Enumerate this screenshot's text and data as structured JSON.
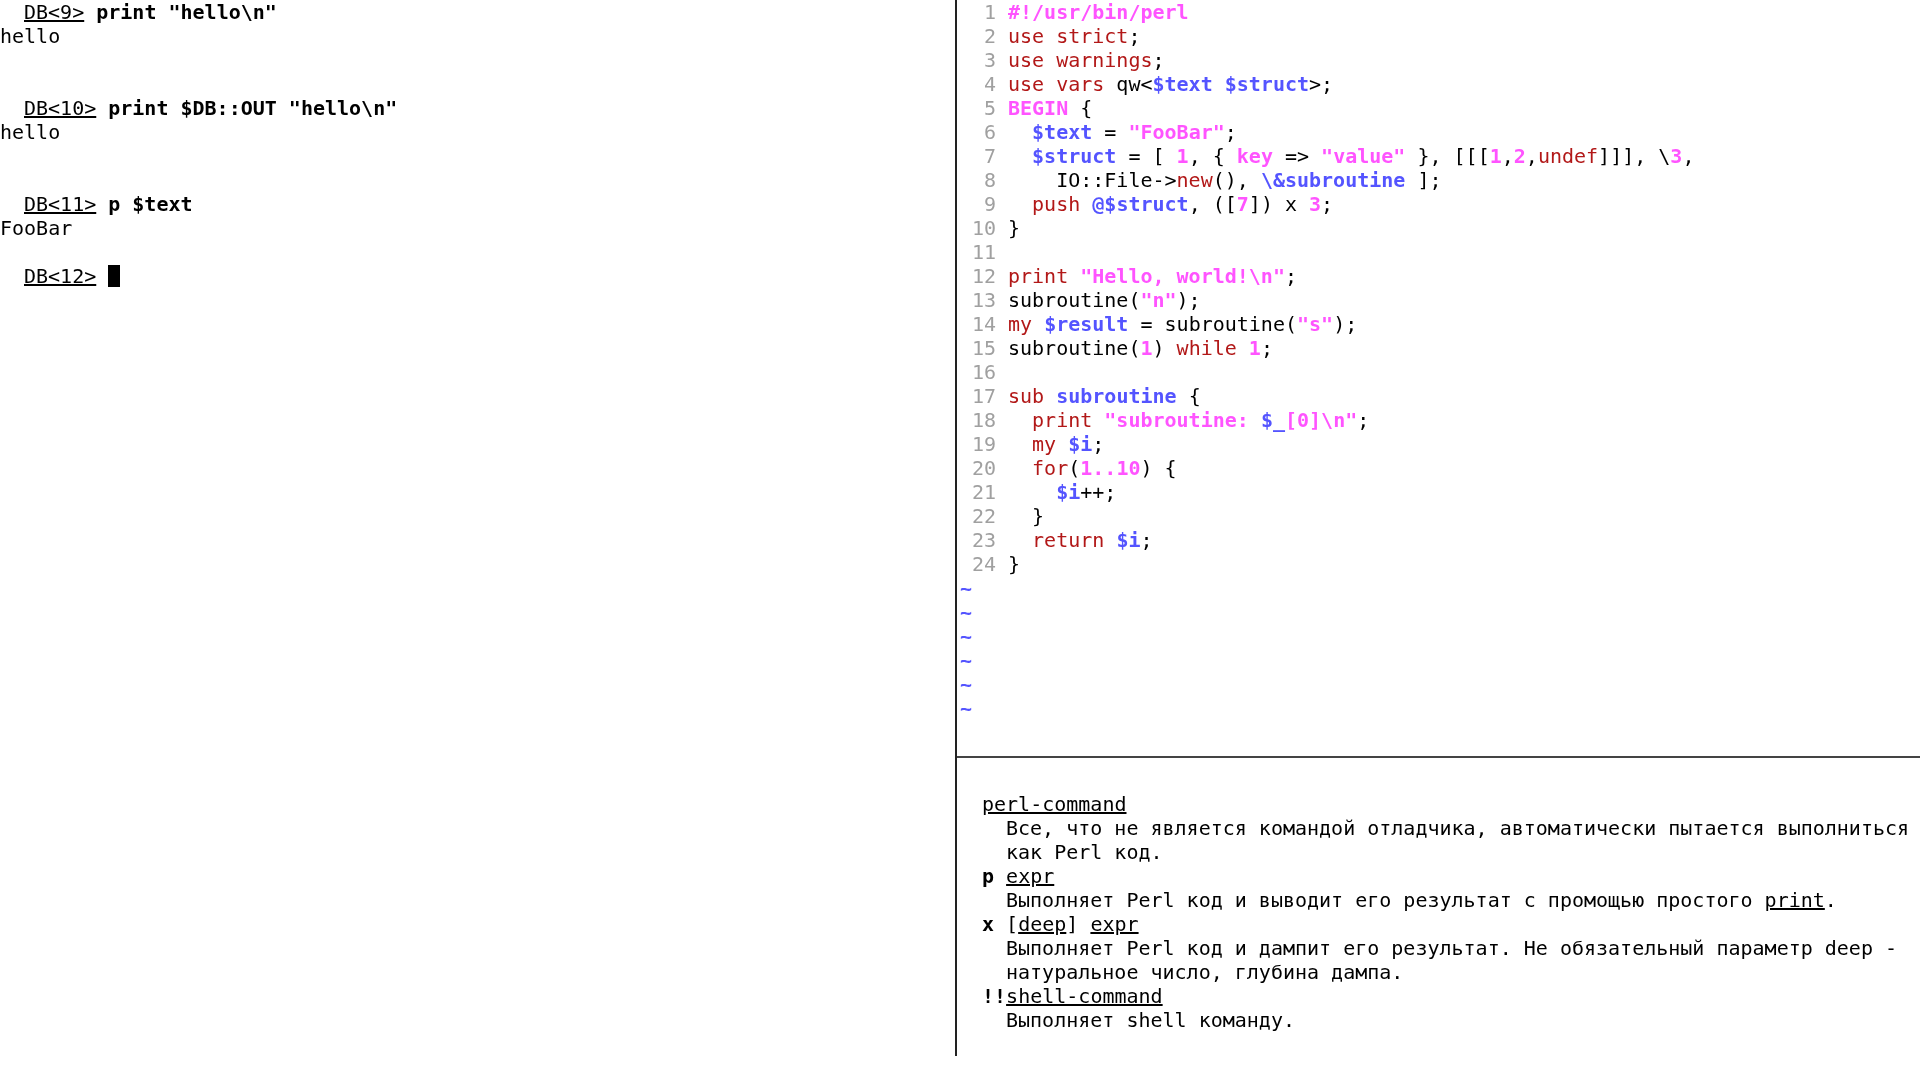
{
  "console": {
    "lines": [
      {
        "kind": "prompt",
        "prompt": "DB<9>",
        "command": "print \"hello\\n\""
      },
      {
        "kind": "output",
        "text": "hello"
      },
      {
        "kind": "blank"
      },
      {
        "kind": "blank"
      },
      {
        "kind": "prompt",
        "prompt": "DB<10>",
        "command": "print $DB::OUT \"hello\\n\""
      },
      {
        "kind": "output",
        "text": "hello"
      },
      {
        "kind": "blank"
      },
      {
        "kind": "blank"
      },
      {
        "kind": "prompt",
        "prompt": "DB<11>",
        "command": "p $text"
      },
      {
        "kind": "output",
        "text": "FooBar"
      },
      {
        "kind": "blank"
      },
      {
        "kind": "prompt",
        "prompt": "DB<12>",
        "cursor": true
      }
    ]
  },
  "editor": {
    "lines": [
      {
        "number": "1",
        "tokens": [
          {
            "kind": "constant",
            "text": "#!/usr/bin/perl"
          }
        ]
      },
      {
        "number": "2",
        "tokens": [
          {
            "kind": "keyword",
            "text": "use strict"
          },
          {
            "kind": "plain",
            "text": ";"
          }
        ]
      },
      {
        "number": "3",
        "tokens": [
          {
            "kind": "keyword",
            "text": "use warnings"
          },
          {
            "kind": "plain",
            "text": ";"
          }
        ]
      },
      {
        "number": "4",
        "tokens": [
          {
            "kind": "keyword",
            "text": "use vars"
          },
          {
            "kind": "plain",
            "text": " qw<"
          },
          {
            "kind": "variable",
            "text": "$text $struct"
          },
          {
            "kind": "plain",
            "text": ">;"
          }
        ]
      },
      {
        "number": "5",
        "tokens": [
          {
            "kind": "constant",
            "text": "BEGIN"
          },
          {
            "kind": "plain",
            "text": " {"
          }
        ]
      },
      {
        "number": "6",
        "tokens": [
          {
            "kind": "variable",
            "text": "  $text"
          },
          {
            "kind": "plain",
            "text": " = "
          },
          {
            "kind": "constant",
            "text": "\"FooBar\""
          },
          {
            "kind": "plain",
            "text": ";"
          }
        ]
      },
      {
        "number": "7",
        "tokens": [
          {
            "kind": "variable",
            "text": "  $struct"
          },
          {
            "kind": "plain",
            "text": " = [ "
          },
          {
            "kind": "constant",
            "text": "1"
          },
          {
            "kind": "plain",
            "text": ", { "
          },
          {
            "kind": "constant",
            "text": "key"
          },
          {
            "kind": "plain",
            "text": " => "
          },
          {
            "kind": "constant",
            "text": "\"value\""
          },
          {
            "kind": "plain",
            "text": " }, [[["
          },
          {
            "kind": "constant",
            "text": "1"
          },
          {
            "kind": "plain",
            "text": ","
          },
          {
            "kind": "constant",
            "text": "2"
          },
          {
            "kind": "plain",
            "text": ","
          },
          {
            "kind": "keyword",
            "text": "undef"
          },
          {
            "kind": "plain",
            "text": "]]], \\"
          },
          {
            "kind": "constant",
            "text": "3"
          },
          {
            "kind": "plain",
            "text": ","
          }
        ]
      },
      {
        "number": "8",
        "tokens": [
          {
            "kind": "plain",
            "text": "    IO::File->"
          },
          {
            "kind": "keyword",
            "text": "new"
          },
          {
            "kind": "plain",
            "text": "(), "
          },
          {
            "kind": "variable",
            "text": "\\&subroutine"
          },
          {
            "kind": "plain",
            "text": " ];"
          }
        ]
      },
      {
        "number": "9",
        "tokens": [
          {
            "kind": "keyword",
            "text": "  push "
          },
          {
            "kind": "variable",
            "text": "@$struct"
          },
          {
            "kind": "plain",
            "text": ", (["
          },
          {
            "kind": "constant",
            "text": "7"
          },
          {
            "kind": "plain",
            "text": "]) x "
          },
          {
            "kind": "constant",
            "text": "3"
          },
          {
            "kind": "plain",
            "text": ";"
          }
        ]
      },
      {
        "number": "10",
        "tokens": [
          {
            "kind": "plain",
            "text": "}"
          }
        ]
      },
      {
        "number": "11"
      },
      {
        "number": "12",
        "tokens": [
          {
            "kind": "keyword",
            "text": "print "
          },
          {
            "kind": "constant",
            "text": "\"Hello, world!\\n\""
          },
          {
            "kind": "plain",
            "text": ";"
          }
        ]
      },
      {
        "number": "13",
        "tokens": [
          {
            "kind": "plain",
            "text": "subroutine("
          },
          {
            "kind": "constant",
            "text": "\"n\""
          },
          {
            "kind": "plain",
            "text": ");"
          }
        ]
      },
      {
        "number": "14",
        "tokens": [
          {
            "kind": "keyword",
            "text": "my "
          },
          {
            "kind": "variable",
            "text": "$result"
          },
          {
            "kind": "plain",
            "text": " = subroutine("
          },
          {
            "kind": "constant",
            "text": "\"s\""
          },
          {
            "kind": "plain",
            "text": ");"
          }
        ]
      },
      {
        "number": "15",
        "tokens": [
          {
            "kind": "plain",
            "text": "subroutine("
          },
          {
            "kind": "constant",
            "text": "1"
          },
          {
            "kind": "plain",
            "text": ") "
          },
          {
            "kind": "keyword",
            "text": "while "
          },
          {
            "kind": "constant",
            "text": "1"
          },
          {
            "kind": "plain",
            "text": ";"
          }
        ]
      },
      {
        "number": "16"
      },
      {
        "number": "17",
        "tokens": [
          {
            "kind": "keyword",
            "text": "sub "
          },
          {
            "kind": "variable",
            "text": "subroutine"
          },
          {
            "kind": "plain",
            "text": " {"
          }
        ]
      },
      {
        "number": "18",
        "tokens": [
          {
            "kind": "keyword",
            "text": "  print "
          },
          {
            "kind": "constant",
            "text": "\"subroutine: "
          },
          {
            "kind": "variable",
            "text": "$_"
          },
          {
            "kind": "constant",
            "text": "[0]\\n\""
          },
          {
            "kind": "plain",
            "text": ";"
          }
        ]
      },
      {
        "number": "19",
        "tokens": [
          {
            "kind": "keyword",
            "text": "  my "
          },
          {
            "kind": "variable",
            "text": "$i"
          },
          {
            "kind": "plain",
            "text": ";"
          }
        ]
      },
      {
        "number": "20",
        "tokens": [
          {
            "kind": "keyword",
            "text": "  for"
          },
          {
            "kind": "plain",
            "text": "("
          },
          {
            "kind": "constant",
            "text": "1..10"
          },
          {
            "kind": "plain",
            "text": ") {"
          }
        ]
      },
      {
        "number": "21",
        "tokens": [
          {
            "kind": "variable",
            "text": "    $i"
          },
          {
            "kind": "plain",
            "text": "++;"
          }
        ]
      },
      {
        "number": "22",
        "tokens": [
          {
            "kind": "plain",
            "text": "  }"
          }
        ]
      },
      {
        "number": "23",
        "tokens": [
          {
            "kind": "keyword",
            "text": "  return "
          },
          {
            "kind": "variable",
            "text": "$i"
          },
          {
            "kind": "plain",
            "text": ";"
          }
        ]
      },
      {
        "number": "24",
        "tokens": [
          {
            "kind": "plain",
            "text": "}"
          }
        ]
      }
    ],
    "filler_lines": [
      "~",
      "~",
      "~",
      "~",
      "~",
      "~"
    ]
  },
  "help": {
    "lines": [
      {
        "kind": "term",
        "segments": [
          {
            "kind": "meta",
            "text": "perl-command"
          }
        ]
      },
      {
        "kind": "desc",
        "segments": [
          {
            "kind": "text",
            "text": "Все, что не является командой отладчика, автоматически пытается выполниться"
          }
        ]
      },
      {
        "kind": "desc",
        "segments": [
          {
            "kind": "text",
            "text": "как Perl код."
          }
        ]
      },
      {
        "kind": "term",
        "segments": [
          {
            "kind": "command",
            "text": "p "
          },
          {
            "kind": "meta",
            "text": "expr"
          }
        ]
      },
      {
        "kind": "desc",
        "segments": [
          {
            "kind": "text",
            "text": "Выполняет Perl код и выводит его результат с промощью простого "
          },
          {
            "kind": "meta",
            "text": "print"
          },
          {
            "kind": "text",
            "text": "."
          }
        ]
      },
      {
        "kind": "term",
        "segments": [
          {
            "kind": "command",
            "text": "x "
          },
          {
            "kind": "text",
            "text": "["
          },
          {
            "kind": "meta",
            "text": "deep"
          },
          {
            "kind": "text",
            "text": "] "
          },
          {
            "kind": "meta",
            "text": "expr"
          }
        ]
      },
      {
        "kind": "desc",
        "segments": [
          {
            "kind": "text",
            "text": "Выполняет Perl код и дампит его результат. Не обязательный параметр deep -"
          }
        ]
      },
      {
        "kind": "desc",
        "segments": [
          {
            "kind": "text",
            "text": "натуральное число, глубина дампа."
          }
        ]
      },
      {
        "kind": "term",
        "segments": [
          {
            "kind": "command",
            "text": "!!"
          },
          {
            "kind": "meta",
            "text": "shell-command"
          }
        ]
      },
      {
        "kind": "desc",
        "segments": [
          {
            "kind": "text",
            "text": "Выполняет shell команду."
          }
        ]
      }
    ]
  }
}
